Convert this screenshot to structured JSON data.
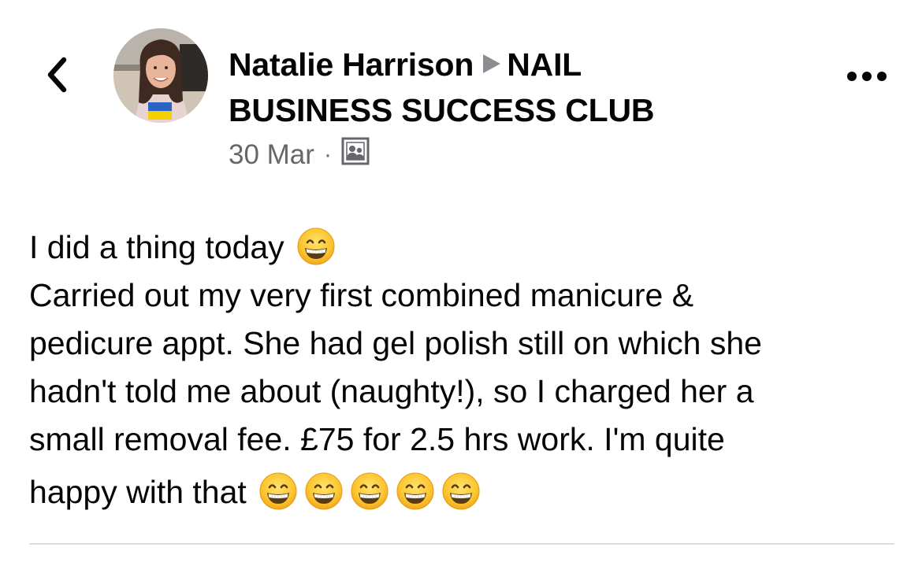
{
  "header": {
    "author_name": "Natalie Harrison",
    "group_name_line1": "NAIL",
    "group_name_line2": "BUSINESS SUCCESS CLUB",
    "date": "30 Mar",
    "separator": "·",
    "audience_icon": "group-audience-icon",
    "back_icon": "chevron-left-icon",
    "more_icon": "more-horizontal-icon"
  },
  "post": {
    "line1": "I did a thing today",
    "line2": "Carried out my very first combined manicure &",
    "line3": "pedicure appt.  She had gel polish still on which she",
    "line4": "hadn't told me about (naughty!), so I charged her a",
    "line5": "small removal fee. £75 for 2.5 hrs work. I'm quite",
    "line6": "happy with that",
    "line1_emoji_count": 1,
    "line6_emoji_count": 5,
    "emoji": "grinning-face-with-smiling-eyes"
  },
  "colors": {
    "text": "#050505",
    "secondary": "#65676b",
    "divider": "#dcdee3",
    "emoji_face": "#fbc530"
  }
}
